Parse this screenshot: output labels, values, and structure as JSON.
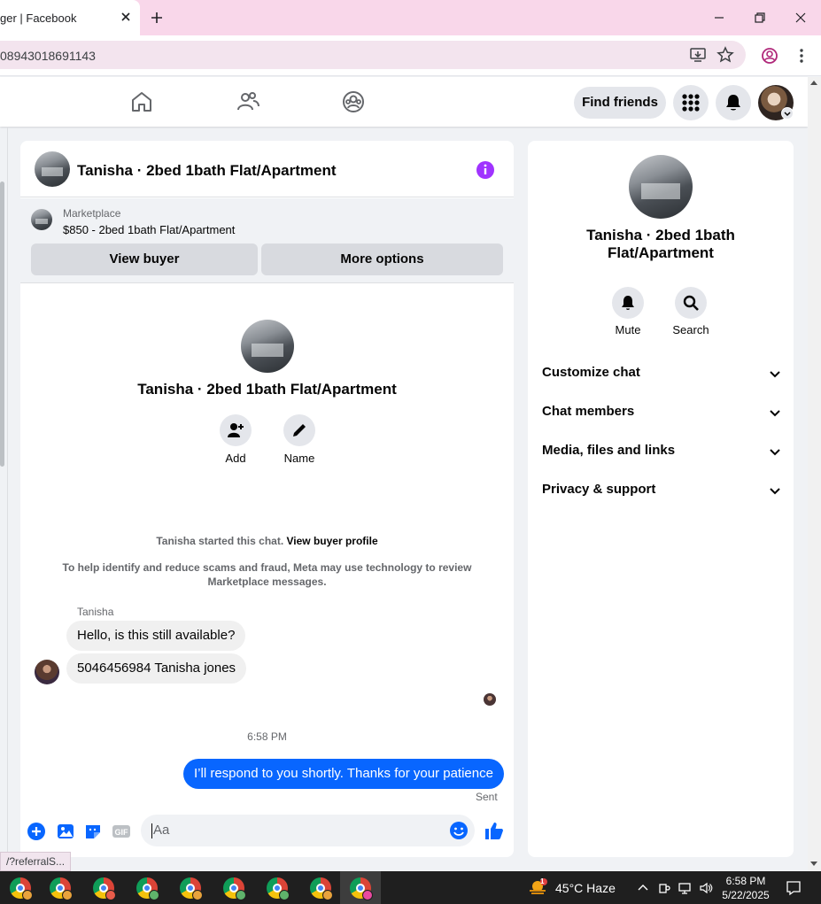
{
  "browser": {
    "tab_title": "ger | Facebook",
    "url": "08943018691143",
    "status_url": "/?referralS..."
  },
  "fb_header": {
    "find_friends_label": "Find friends",
    "icons": [
      "home-icon",
      "friends-icon",
      "groups-icon",
      "menu-grid-icon",
      "notifications-bell-icon"
    ]
  },
  "conversation": {
    "title": "Tanisha · 2bed 1bath Flat/Apartment",
    "marketplace_label": "Marketplace",
    "listing_price_title": "$850 - 2bed 1bath Flat/Apartment",
    "view_buyer_label": "View buyer",
    "more_options_label": "More options",
    "center_title": "Tanisha · 2bed 1bath Flat/Apartment",
    "add_label": "Add",
    "name_label": "Name",
    "started_text": "Tanisha started this chat.",
    "view_buyer_profile_label": "View buyer profile",
    "scam_notice_line1": "To help identify and reduce scams and fraud, Meta may use technology to review",
    "scam_notice_line2": "Marketplace messages.",
    "sender_name": "Tanisha",
    "messages_in": [
      "Hello, is this still available?",
      "5046456984 Tanisha jones"
    ],
    "timestamp": "6:58 PM",
    "message_out": "I’ll respond to you shortly. Thanks for your patience",
    "sent_label": "Sent",
    "composer_placeholder": "Aa"
  },
  "right_panel": {
    "title_line1": "Tanisha · 2bed 1bath",
    "title_line2": "Flat/Apartment",
    "mute_label": "Mute",
    "search_label": "Search",
    "sections": [
      "Customize chat",
      "Chat members",
      "Media, files and links",
      "Privacy & support"
    ]
  },
  "taskbar": {
    "weather": "45°C  Haze",
    "weather_badge": "1",
    "time": "6:58 PM",
    "date": "5/22/2025",
    "profile_colors": [
      "#e8a33c",
      "#e8a33c",
      "#e85c4a",
      "#5fb36b",
      "#e8a33c",
      "#5fb36b",
      "#5fb36b",
      "#e8a33c",
      "#e84aa0"
    ]
  },
  "colors": {
    "accent_blue": "#0866ff",
    "info_purple": "#a033ff",
    "tab_strip_pink": "#f9d7ea"
  }
}
